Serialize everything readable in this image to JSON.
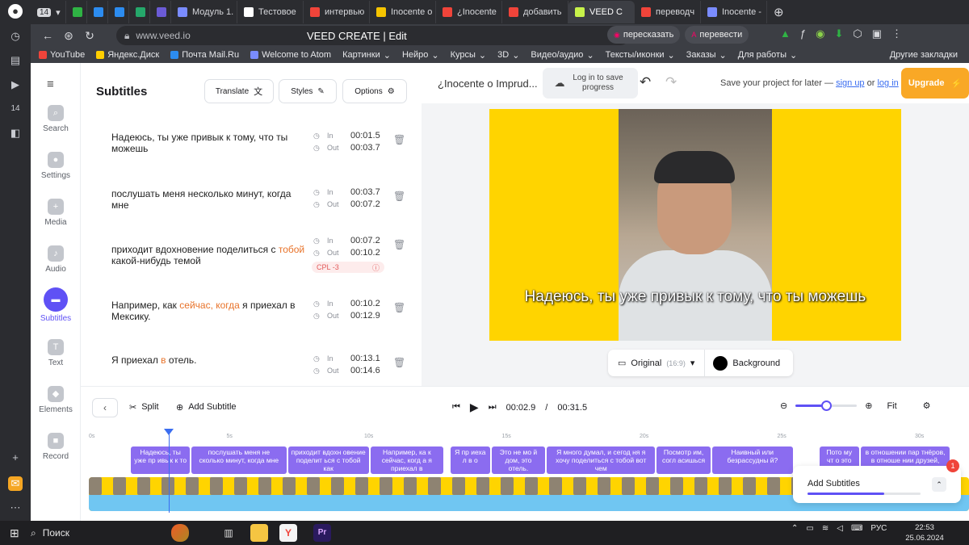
{
  "browser": {
    "tab_count": "14",
    "tabs": [
      {
        "label": "",
        "color": "#2fb344"
      },
      {
        "label": "",
        "color": "#2c8cf0"
      },
      {
        "label": "",
        "color": "#2c8cf0"
      },
      {
        "label": "",
        "color": "#25a86b"
      },
      {
        "label": "",
        "color": "#6b5bd6"
      },
      {
        "label": "Модуль 1.",
        "color": "#7a8cff"
      },
      {
        "label": "Тестовое",
        "color": "#ffffff"
      },
      {
        "label": "интервью",
        "color": "#f0443a"
      },
      {
        "label": "Inocente o",
        "color": "#f5c400"
      },
      {
        "label": "¿Inocente",
        "color": "#f0443a"
      },
      {
        "label": "добавить",
        "color": "#f0443a"
      },
      {
        "label": "VEED C",
        "color": "#c7f24a"
      },
      {
        "label": "переводч",
        "color": "#f0443a"
      },
      {
        "label": "Inocente -",
        "color": "#7a8cff"
      }
    ],
    "url": "www.veed.io",
    "page_title": "VEED CREATE | Edit",
    "ext_retell": "пересказать",
    "ext_translate": "перевести",
    "bookmarks": [
      "YouTube",
      "Яндекс.Диск",
      "Почта Mail.Ru",
      "Welcome to Atom",
      "Картинки",
      "Нейро",
      "Курсы",
      "3D",
      "Видео/аудио",
      "Тексты/иконки",
      "Заказы",
      "Для работы"
    ],
    "other_bookmarks": "Другие закладки"
  },
  "rail": [
    {
      "label": "Search",
      "icon": "search-icon"
    },
    {
      "label": "Settings",
      "icon": "settings-icon"
    },
    {
      "label": "Media",
      "icon": "plus-icon"
    },
    {
      "label": "Audio",
      "icon": "music-note-icon"
    },
    {
      "label": "Subtitles",
      "icon": "subtitles-icon",
      "active": true
    },
    {
      "label": "Text",
      "icon": "text-icon"
    },
    {
      "label": "Elements",
      "icon": "elements-icon"
    },
    {
      "label": "Record",
      "icon": "record-icon"
    }
  ],
  "panel": {
    "title": "Subtitles",
    "translate": "Translate",
    "styles": "Styles",
    "options": "Options",
    "in_label": "In",
    "out_label": "Out",
    "subtitles": [
      {
        "pre": "Надеюсь, ты уже привык к тому, что ты можешь",
        "hl": "",
        "post": "",
        "in": "00:01.5",
        "out": "00:03.7"
      },
      {
        "pre": "послушать меня несколько минут, когда мне",
        "hl": "",
        "post": "",
        "in": "00:03.7",
        "out": "00:07.2"
      },
      {
        "pre": "приходит вдохновение поделиться с ",
        "hl": "тобой",
        "post": " какой-нибудь темой",
        "in": "00:07.2",
        "out": "00:10.2"
      },
      {
        "pre": "Например, как ",
        "hl": "сейчас, когда",
        "post": " я приехал в Мексику.",
        "in": "00:10.2",
        "out": "00:12.9"
      },
      {
        "pre": "Я приехал ",
        "hl": "в",
        "post": " отель.",
        "in": "00:13.1",
        "out": "00:14.6"
      }
    ],
    "cpl_label": "CPL",
    "cpl_value": "-3"
  },
  "header": {
    "project_name": "¿Inocente o Imprud...",
    "login_save": "Log in to save progress",
    "save_prompt": "Save your project for later —",
    "sign_up": "sign up",
    "or": "or",
    "log_in": "log in",
    "upgrade": "Upgrade"
  },
  "video": {
    "caption": "Надеюсь, ты уже привык к тому, что ты можешь",
    "original_label": "Original",
    "ratio": "(16:9)",
    "background_label": "Background",
    "accent": "#ffd400"
  },
  "timeline": {
    "split": "Split",
    "add_subtitle": "Add Subtitle",
    "current_time": "00:02.9",
    "total_time": "00:31.5",
    "fit": "Fit",
    "zoom_level": 0.5,
    "ruler": [
      "0s",
      "5s",
      "10s",
      "15s",
      "20s",
      "25s",
      "30s"
    ],
    "chips": [
      {
        "text": "Надеюсь, ты уже пр ивык к то",
        "start": 1.5,
        "end": 3.7
      },
      {
        "text": "послушать меня не сколько минут, когда мне",
        "start": 3.7,
        "end": 7.2
      },
      {
        "text": "приходит вдохн овение поделит ься с тобой как",
        "start": 7.2,
        "end": 10.2
      },
      {
        "text": "Например, ка к сейчас, когд а я приехал в",
        "start": 10.2,
        "end": 12.9
      },
      {
        "text": "Я пр иеха л в о",
        "start": 13.1,
        "end": 14.6
      },
      {
        "text": "Это не мо й дом, это отель.",
        "start": 14.6,
        "end": 16.6
      },
      {
        "text": "Я много думал, и сегод ня я хочу поделиться с тобой вот чем",
        "start": 16.6,
        "end": 20.6
      },
      {
        "text": "Посмотр им, согл асишься",
        "start": 20.6,
        "end": 22.6
      },
      {
        "text": "Наивный или безрассудны й?",
        "start": 22.6,
        "end": 25.6
      },
      {
        "text": "Пото му чт о это",
        "start": 26.5,
        "end": 28.0
      },
      {
        "text": "в отношении пар тнёров, в отноше нии друзей,",
        "start": 28.0,
        "end": 31.3
      }
    ]
  },
  "toast": {
    "label": "Add Subtitles",
    "progress": 0.68,
    "badge": "1"
  },
  "taskbar": {
    "search": "Поиск",
    "lang": "РУС",
    "time": "22:53",
    "date": "25.06.2024"
  }
}
